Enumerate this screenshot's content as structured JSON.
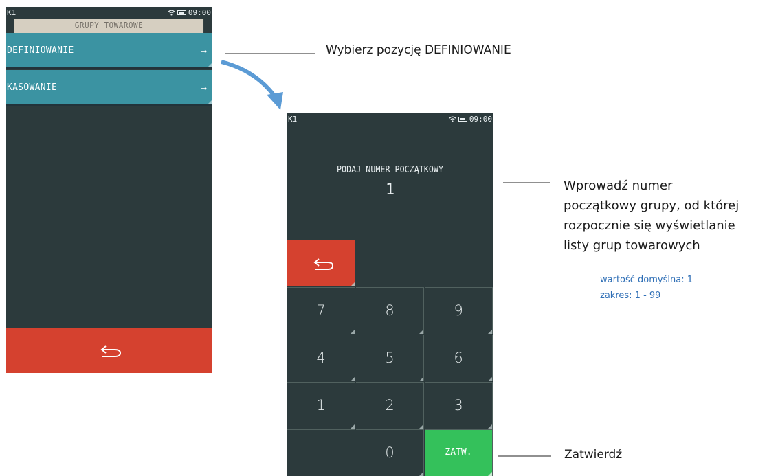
{
  "screen1": {
    "status": {
      "left": "K1",
      "time": "09:00"
    },
    "title": "GRUPY TOWAROWE",
    "menu": [
      {
        "label": "DEFINIOWANIE",
        "arrow": "→"
      },
      {
        "label": "KASOWANIE",
        "arrow": "→"
      }
    ],
    "back_icon": "back-arrow-icon",
    "colors": {
      "menu": "#3b93a2",
      "back": "#d5412f",
      "background": "#2c3a3c",
      "title_bar": "#d6cfc1"
    }
  },
  "screen2": {
    "status": {
      "left": "K1",
      "time": "09:00"
    },
    "prompt": "PODAJ NUMER POCZĄTKOWY",
    "value": "1",
    "back_icon": "back-arrow-icon",
    "keys": [
      "7",
      "8",
      "9",
      "4",
      "5",
      "6",
      "1",
      "2",
      "3",
      "",
      "0",
      "ZATW."
    ],
    "colors": {
      "confirm": "#34c15b",
      "back": "#d5412f"
    }
  },
  "annotations": {
    "select": "Wybierz pozycję DEFINIOWANIE",
    "enter_line1": "Wprowadź numer",
    "enter_line2": "początkowy grupy, od której",
    "enter_line3": "rozpocznie się wyświetlanie",
    "enter_line4": "listy grup towarowych",
    "default_value": "wartość domyślna: 1",
    "range": "zakres:  1 - 99",
    "confirm": "Zatwierdź",
    "arrow_color": "#5b9bd5",
    "note_color": "#2f6fb6"
  }
}
